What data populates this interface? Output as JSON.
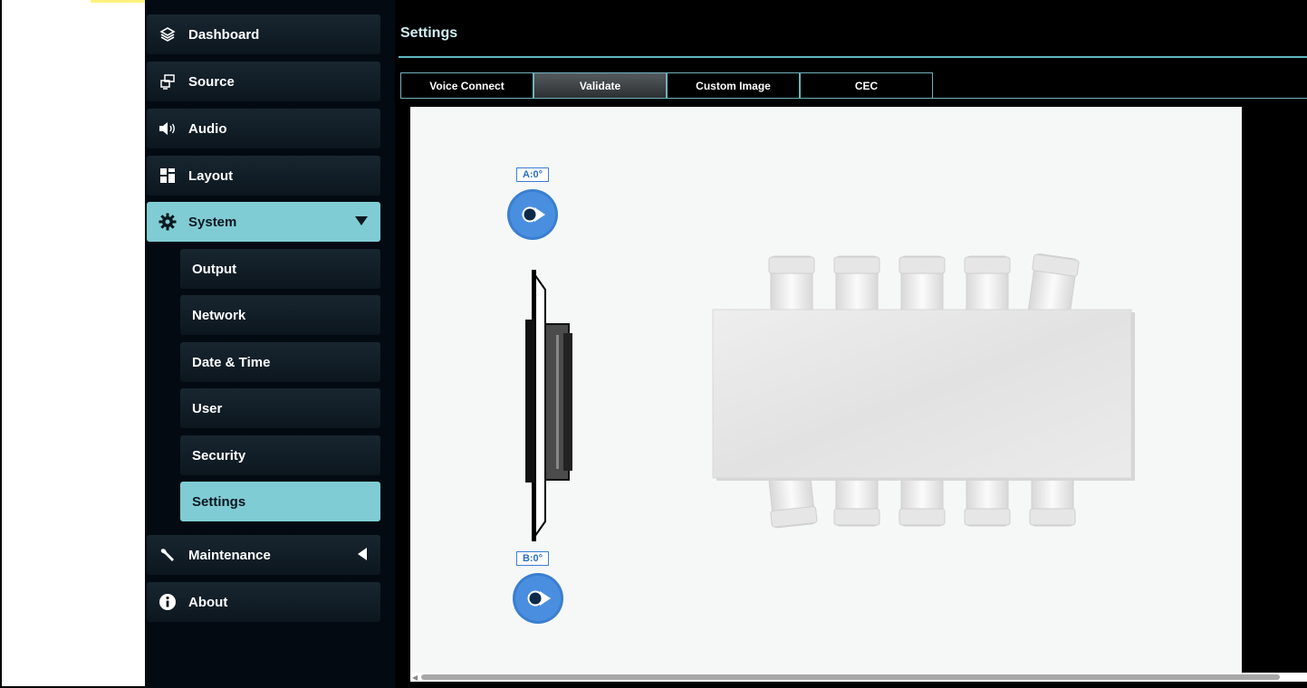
{
  "sidebar": {
    "items": [
      {
        "label": "Dashboard",
        "icon": "dashboard-icon"
      },
      {
        "label": "Source",
        "icon": "source-icon"
      },
      {
        "label": "Audio",
        "icon": "audio-icon"
      },
      {
        "label": "Layout",
        "icon": "layout-icon"
      },
      {
        "label": "System",
        "icon": "gear-icon",
        "expanded": true
      },
      {
        "label": "Maintenance",
        "icon": "wrench-icon"
      },
      {
        "label": "About",
        "icon": "info-icon"
      }
    ],
    "system_subitems": [
      {
        "label": "Output"
      },
      {
        "label": "Network"
      },
      {
        "label": "Date & Time"
      },
      {
        "label": "User"
      },
      {
        "label": "Security"
      },
      {
        "label": "Settings",
        "active": true
      }
    ]
  },
  "main": {
    "title": "Settings",
    "tabs": [
      {
        "label": "Voice Connect"
      },
      {
        "label": "Validate",
        "active": true
      },
      {
        "label": "Custom Image"
      },
      {
        "label": "CEC"
      }
    ],
    "cameras": [
      {
        "label": "A:0°"
      },
      {
        "label": "B:0°"
      }
    ]
  },
  "colors": {
    "accent": "#80ccd4",
    "sidebar_bg": "#030a12",
    "camera_blue": "#3a7fd0"
  }
}
